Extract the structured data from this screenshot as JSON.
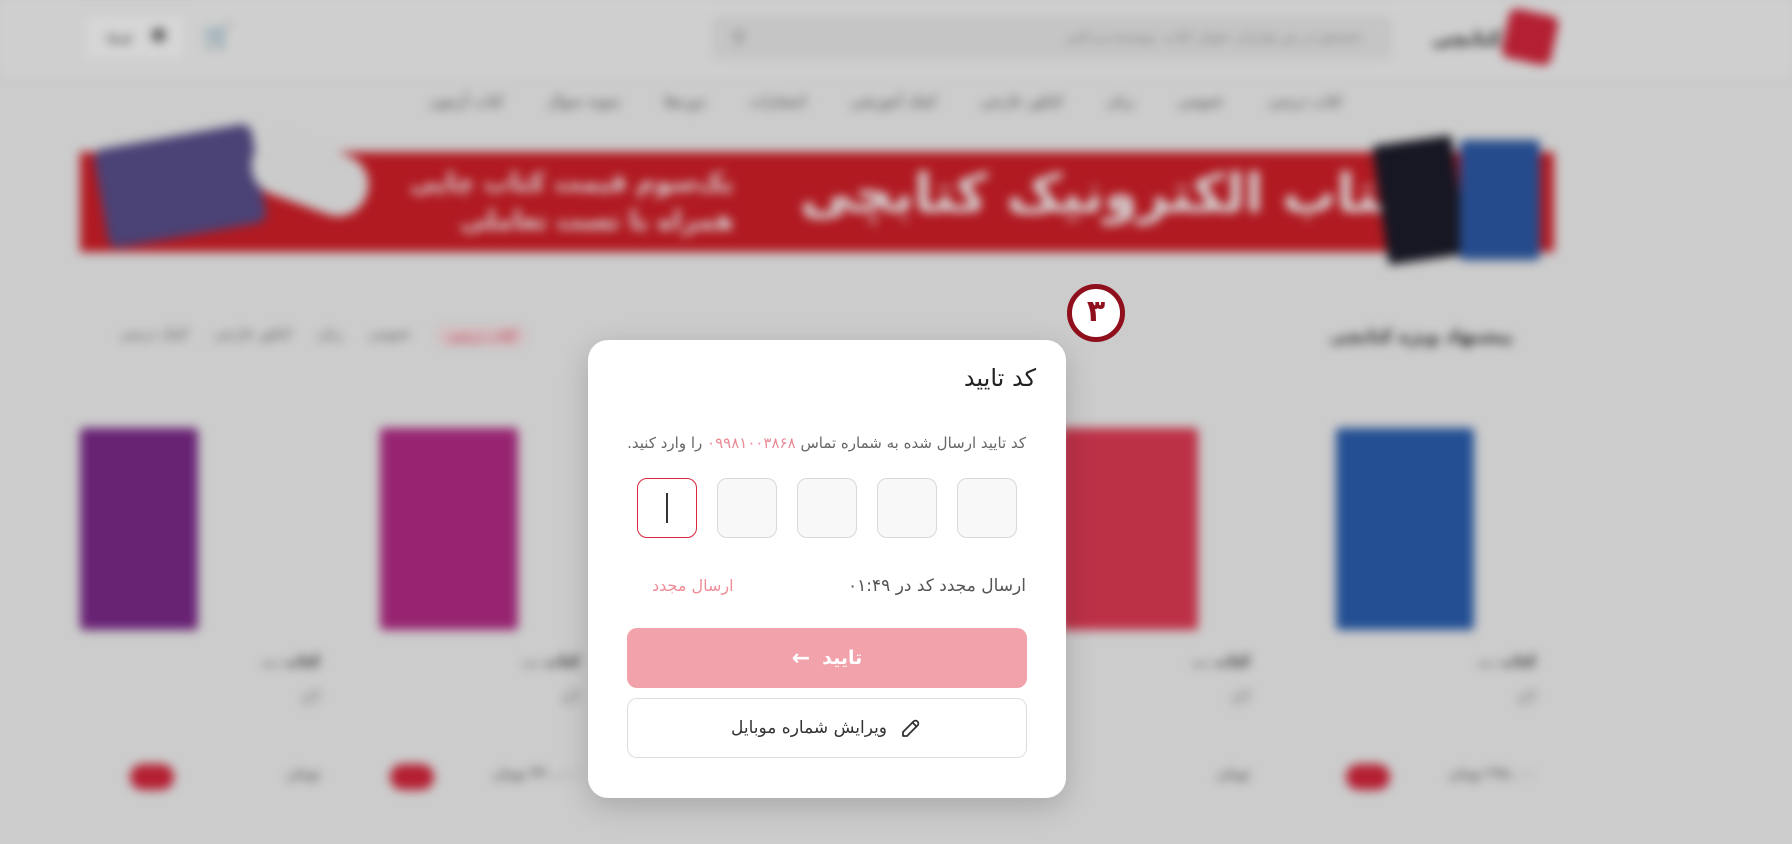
{
  "header": {
    "logo_text": "کتابچی",
    "search_placeholder": "جستجو در بین هزاران عنوان کتاب، نویسنده و ناشر",
    "login_label": "ورود"
  },
  "nav": {
    "items": [
      "کتاب درسی",
      "عمومی",
      "زبان",
      "کنکور خارجی",
      "کمک آموزشی",
      "انتشارات",
      "دوره‌ها",
      "نمونه سوال",
      "کتاب آزمون"
    ]
  },
  "banner": {
    "title": "کتاب الکترونیک کتابچی",
    "line1": "یک‌سوم قیمت کتاب چاپی",
    "line2": "همراه با تست تعاملی"
  },
  "section": {
    "title": "پیشنهاد ویژه کتابچی",
    "tabs": [
      "کتاب درسی",
      "عمومی",
      "زبان",
      "کنکور خارجی",
      "کمک درسی"
    ]
  },
  "cards": [
    {
      "title": "کتاب ...",
      "author": "گاج",
      "price": "۲۹۸,۰۰۰ تومان"
    },
    {
      "title": "کتاب ...",
      "author": "گاج",
      "price": "تومان"
    },
    {
      "title": "کتاب ...",
      "author": "گاج",
      "price": "۳۳۰,۰۰۰ تومان"
    },
    {
      "title": "کتاب ...",
      "author": "گاج",
      "price": "تومان"
    }
  ],
  "step_marker": "۳",
  "modal": {
    "title": "کد تایید",
    "desc_prefix": "کد تایید ارسال شده به شماره تماس",
    "phone": "۰۹۹۸۱۰۰۳۸۶۸",
    "desc_suffix": "را وارد کنید.",
    "resend_timer": "ارسال مجدد کد در ۰۱:۴۹",
    "resend_link": "ارسال مجدد",
    "confirm_label": "تایید",
    "edit_label": "ویرایش شماره موبایل",
    "arrow_icon": "arrow-left-icon",
    "edit_icon": "pencil-icon"
  },
  "colors": {
    "accent": "#d7263d",
    "confirm_disabled": "#f1a2aa",
    "resend": "#ef8d98",
    "marker": "#8f0f1c"
  }
}
